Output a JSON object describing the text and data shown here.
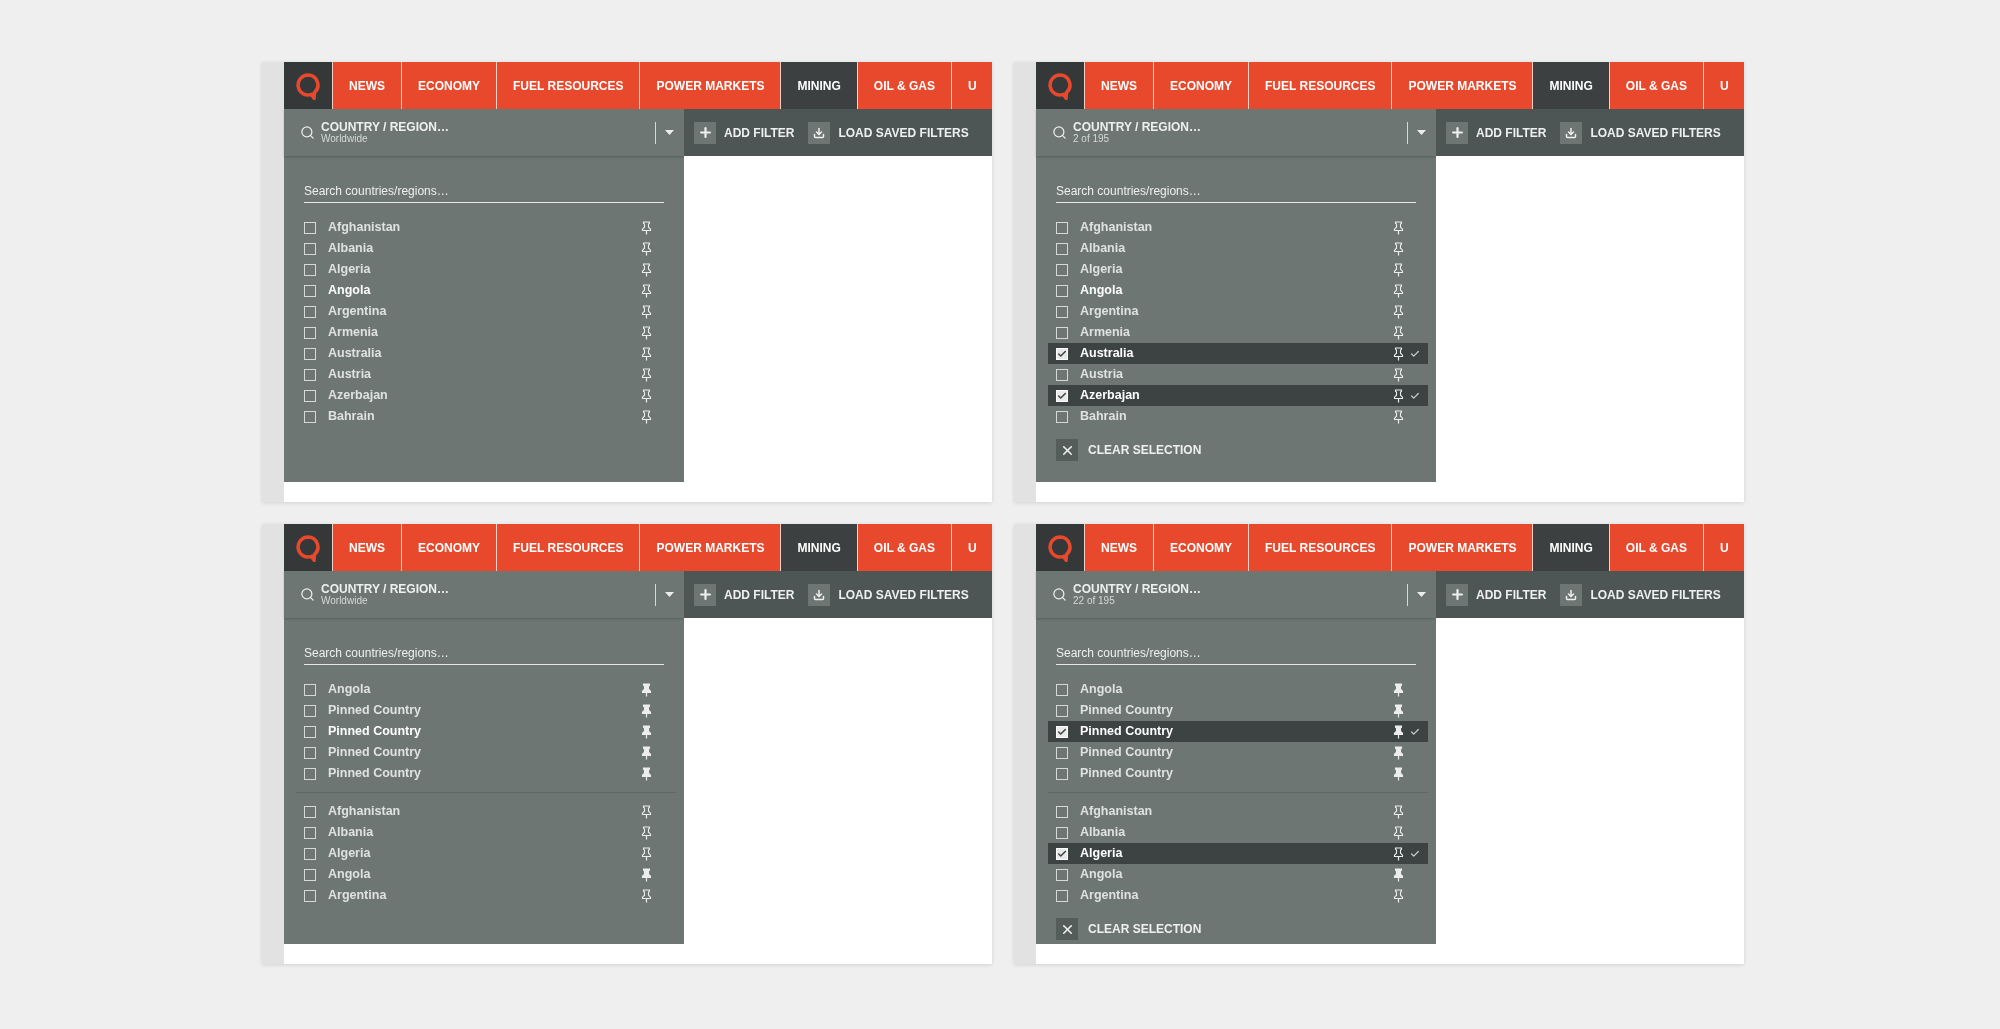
{
  "panels": [
    {
      "nav": [
        {
          "label": "NEWS",
          "selected": false
        },
        {
          "label": "ECONOMY",
          "selected": false
        },
        {
          "label": "FUEL RESOURCES",
          "selected": false
        },
        {
          "label": "POWER MARKETS",
          "selected": false
        },
        {
          "label": "MINING",
          "selected": true
        },
        {
          "label": "OIL & GAS",
          "selected": false
        },
        {
          "label": "U",
          "selected": false
        }
      ],
      "filter": {
        "title": "COUNTRY / REGION…",
        "summary": "Worldwide"
      },
      "search": {
        "placeholder": "Search countries/regions…"
      },
      "actions": [
        {
          "kind": "add",
          "label": "ADD FILTER"
        },
        {
          "kind": "load",
          "label": "LOAD SAVED FILTERS"
        }
      ],
      "groups": [
        {
          "items": [
            {
              "label": "Afghanistan",
              "checked": false,
              "pinned": false,
              "highlighted": false
            },
            {
              "label": "Albania",
              "checked": false,
              "pinned": false,
              "highlighted": false
            },
            {
              "label": "Algeria",
              "checked": false,
              "pinned": false,
              "highlighted": false
            },
            {
              "label": "Angola",
              "checked": false,
              "pinned": false,
              "highlighted": true
            },
            {
              "label": "Argentina",
              "checked": false,
              "pinned": false,
              "highlighted": false
            },
            {
              "label": "Armenia",
              "checked": false,
              "pinned": false,
              "highlighted": false
            },
            {
              "label": "Australia",
              "checked": false,
              "pinned": false,
              "highlighted": false
            },
            {
              "label": "Austria",
              "checked": false,
              "pinned": false,
              "highlighted": false
            },
            {
              "label": "Azerbajan",
              "checked": false,
              "pinned": false,
              "highlighted": false
            },
            {
              "label": "Bahrain",
              "checked": false,
              "pinned": false,
              "highlighted": false
            }
          ]
        }
      ]
    },
    {
      "nav": [
        {
          "label": "NEWS",
          "selected": false
        },
        {
          "label": "ECONOMY",
          "selected": false
        },
        {
          "label": "FUEL RESOURCES",
          "selected": false
        },
        {
          "label": "POWER MARKETS",
          "selected": false
        },
        {
          "label": "MINING",
          "selected": true
        },
        {
          "label": "OIL & GAS",
          "selected": false
        },
        {
          "label": "U",
          "selected": false
        }
      ],
      "filter": {
        "title": "COUNTRY / REGION…",
        "summary": "2 of 195"
      },
      "search": {
        "placeholder": "Search countries/regions…"
      },
      "actions": [
        {
          "kind": "add",
          "label": "ADD FILTER"
        },
        {
          "kind": "load",
          "label": "LOAD SAVED FILTERS"
        }
      ],
      "groups": [
        {
          "items": [
            {
              "label": "Afghanistan",
              "checked": false,
              "pinned": false,
              "highlighted": false
            },
            {
              "label": "Albania",
              "checked": false,
              "pinned": false,
              "highlighted": false
            },
            {
              "label": "Algeria",
              "checked": false,
              "pinned": false,
              "highlighted": false
            },
            {
              "label": "Angola",
              "checked": false,
              "pinned": false,
              "highlighted": true
            },
            {
              "label": "Argentina",
              "checked": false,
              "pinned": false,
              "highlighted": false
            },
            {
              "label": "Armenia",
              "checked": false,
              "pinned": false,
              "highlighted": false
            },
            {
              "label": "Australia",
              "checked": true,
              "pinned": false
            },
            {
              "label": "Austria",
              "checked": false,
              "pinned": false,
              "highlighted": false
            },
            {
              "label": "Azerbajan",
              "checked": true,
              "pinned": false
            },
            {
              "label": "Bahrain",
              "checked": false,
              "pinned": false,
              "highlighted": false
            }
          ]
        }
      ],
      "clear_button": "CLEAR SELECTION"
    },
    {
      "nav": [
        {
          "label": "NEWS",
          "selected": false
        },
        {
          "label": "ECONOMY",
          "selected": false
        },
        {
          "label": "FUEL RESOURCES",
          "selected": false
        },
        {
          "label": "POWER MARKETS",
          "selected": false
        },
        {
          "label": "MINING",
          "selected": true
        },
        {
          "label": "OIL & GAS",
          "selected": false
        },
        {
          "label": "U",
          "selected": false
        }
      ],
      "filter": {
        "title": "COUNTRY / REGION…",
        "summary": "Worldwide"
      },
      "search": {
        "placeholder": "Search countries/regions…"
      },
      "actions": [
        {
          "kind": "add",
          "label": "ADD FILTER"
        },
        {
          "kind": "load",
          "label": "LOAD SAVED FILTERS"
        }
      ],
      "groups": [
        {
          "items": [
            {
              "label": "Angola",
              "checked": false,
              "pinned": true,
              "highlighted": false
            },
            {
              "label": "Pinned Country",
              "checked": false,
              "pinned": true,
              "highlighted": false
            },
            {
              "label": "Pinned Country",
              "checked": false,
              "pinned": true,
              "highlighted": true
            },
            {
              "label": "Pinned Country",
              "checked": false,
              "pinned": true,
              "highlighted": false
            },
            {
              "label": "Pinned Country",
              "checked": false,
              "pinned": true,
              "highlighted": false
            }
          ]
        },
        {
          "items": [
            {
              "label": "Afghanistan",
              "checked": false,
              "pinned": false,
              "highlighted": false
            },
            {
              "label": "Albania",
              "checked": false,
              "pinned": false,
              "highlighted": false
            },
            {
              "label": "Algeria",
              "checked": false,
              "pinned": false,
              "highlighted": false
            },
            {
              "label": "Angola",
              "checked": false,
              "pinned": true,
              "highlighted": false
            },
            {
              "label": "Argentina",
              "checked": false,
              "pinned": false,
              "highlighted": false
            }
          ]
        }
      ]
    },
    {
      "nav": [
        {
          "label": "NEWS",
          "selected": false
        },
        {
          "label": "ECONOMY",
          "selected": false
        },
        {
          "label": "FUEL RESOURCES",
          "selected": false
        },
        {
          "label": "POWER MARKETS",
          "selected": false
        },
        {
          "label": "MINING",
          "selected": true
        },
        {
          "label": "OIL & GAS",
          "selected": false
        },
        {
          "label": "U",
          "selected": false
        }
      ],
      "filter": {
        "title": "COUNTRY / REGION…",
        "summary": "22 of 195"
      },
      "search": {
        "placeholder": "Search countries/regions…"
      },
      "actions": [
        {
          "kind": "add",
          "label": "ADD FILTER"
        },
        {
          "kind": "load",
          "label": "LOAD SAVED FILTERS"
        }
      ],
      "groups": [
        {
          "items": [
            {
              "label": "Angola",
              "checked": false,
              "pinned": true,
              "highlighted": false
            },
            {
              "label": "Pinned Country",
              "checked": false,
              "pinned": true,
              "highlighted": false
            },
            {
              "label": "Pinned Country",
              "checked": true,
              "pinned": true
            },
            {
              "label": "Pinned Country",
              "checked": false,
              "pinned": true,
              "highlighted": false
            },
            {
              "label": "Pinned Country",
              "checked": false,
              "pinned": true,
              "highlighted": false
            }
          ]
        },
        {
          "items": [
            {
              "label": "Afghanistan",
              "checked": false,
              "pinned": false,
              "highlighted": false
            },
            {
              "label": "Albania",
              "checked": false,
              "pinned": false,
              "highlighted": false
            },
            {
              "label": "Algeria",
              "checked": true,
              "pinned": false
            },
            {
              "label": "Angola",
              "checked": false,
              "pinned": true,
              "highlighted": false
            },
            {
              "label": "Argentina",
              "checked": false,
              "pinned": false,
              "highlighted": false
            }
          ]
        }
      ],
      "clear_button": "CLEAR SELECTION"
    }
  ]
}
